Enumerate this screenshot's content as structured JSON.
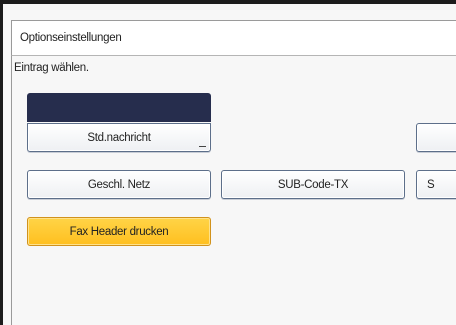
{
  "window": {
    "title": "Optionseinstellungen"
  },
  "main": {
    "prompt": "Eintrag wählen.",
    "buttons": {
      "std_nachricht": "Std.nachricht",
      "geschl_netz": "Geschl. Netz",
      "sub_code_tx": "SUB-Code-TX",
      "sep_partial": "S",
      "fax_header": "Fax Header drucken"
    }
  }
}
